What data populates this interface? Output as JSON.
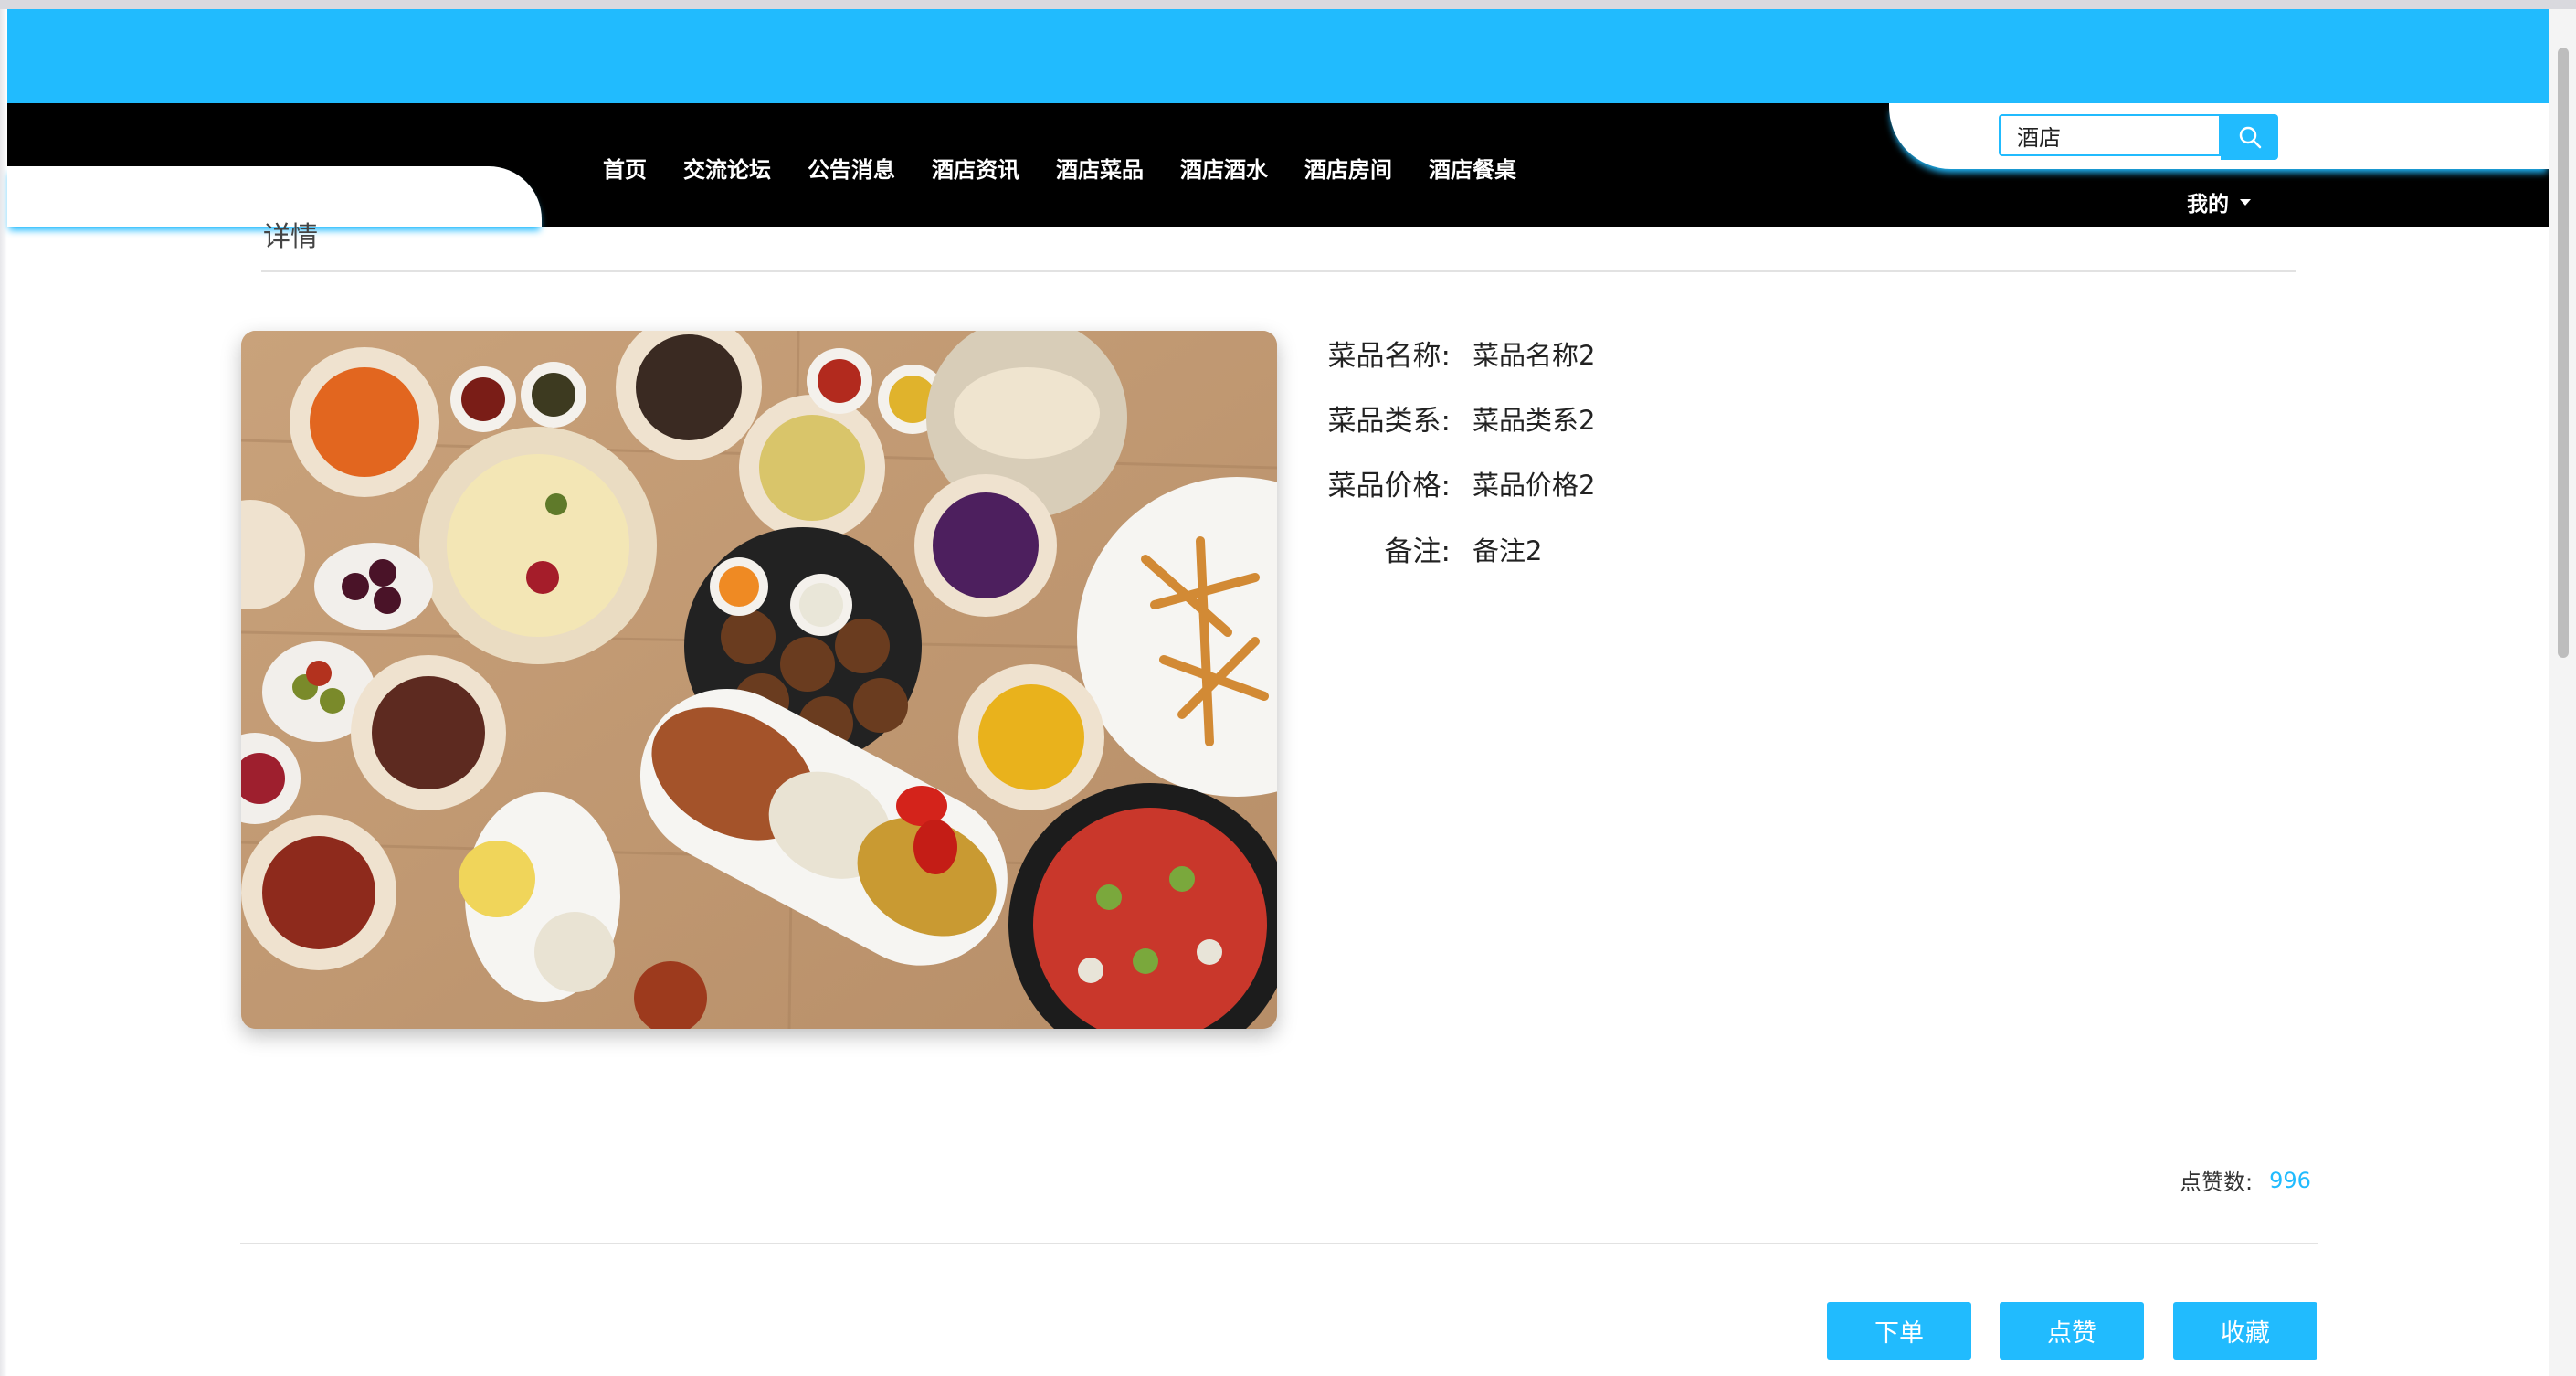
{
  "nav": {
    "items": [
      {
        "label": "首页"
      },
      {
        "label": "交流论坛"
      },
      {
        "label": "公告消息"
      },
      {
        "label": "酒店资讯"
      },
      {
        "label": "酒店菜品"
      },
      {
        "label": "酒店酒水"
      },
      {
        "label": "酒店房间"
      },
      {
        "label": "酒店餐桌"
      }
    ]
  },
  "search": {
    "value": "酒店",
    "icon": "search-icon"
  },
  "user_menu": {
    "label": "我的",
    "icon": "caret-down-icon"
  },
  "page": {
    "section_title": "详情"
  },
  "details": [
    {
      "label": "菜品名称:",
      "value": "菜品名称2"
    },
    {
      "label": "菜品类系:",
      "value": "菜品类系2"
    },
    {
      "label": "菜品价格:",
      "value": "菜品价格2"
    },
    {
      "label": "备注:",
      "value": "备注2"
    }
  ],
  "likes": {
    "label": "点赞数:",
    "count": "996"
  },
  "actions": {
    "order": "下单",
    "like": "点赞",
    "favorite": "收藏"
  },
  "colors": {
    "accent": "#21bbfe",
    "nav_bg": "#000000"
  }
}
